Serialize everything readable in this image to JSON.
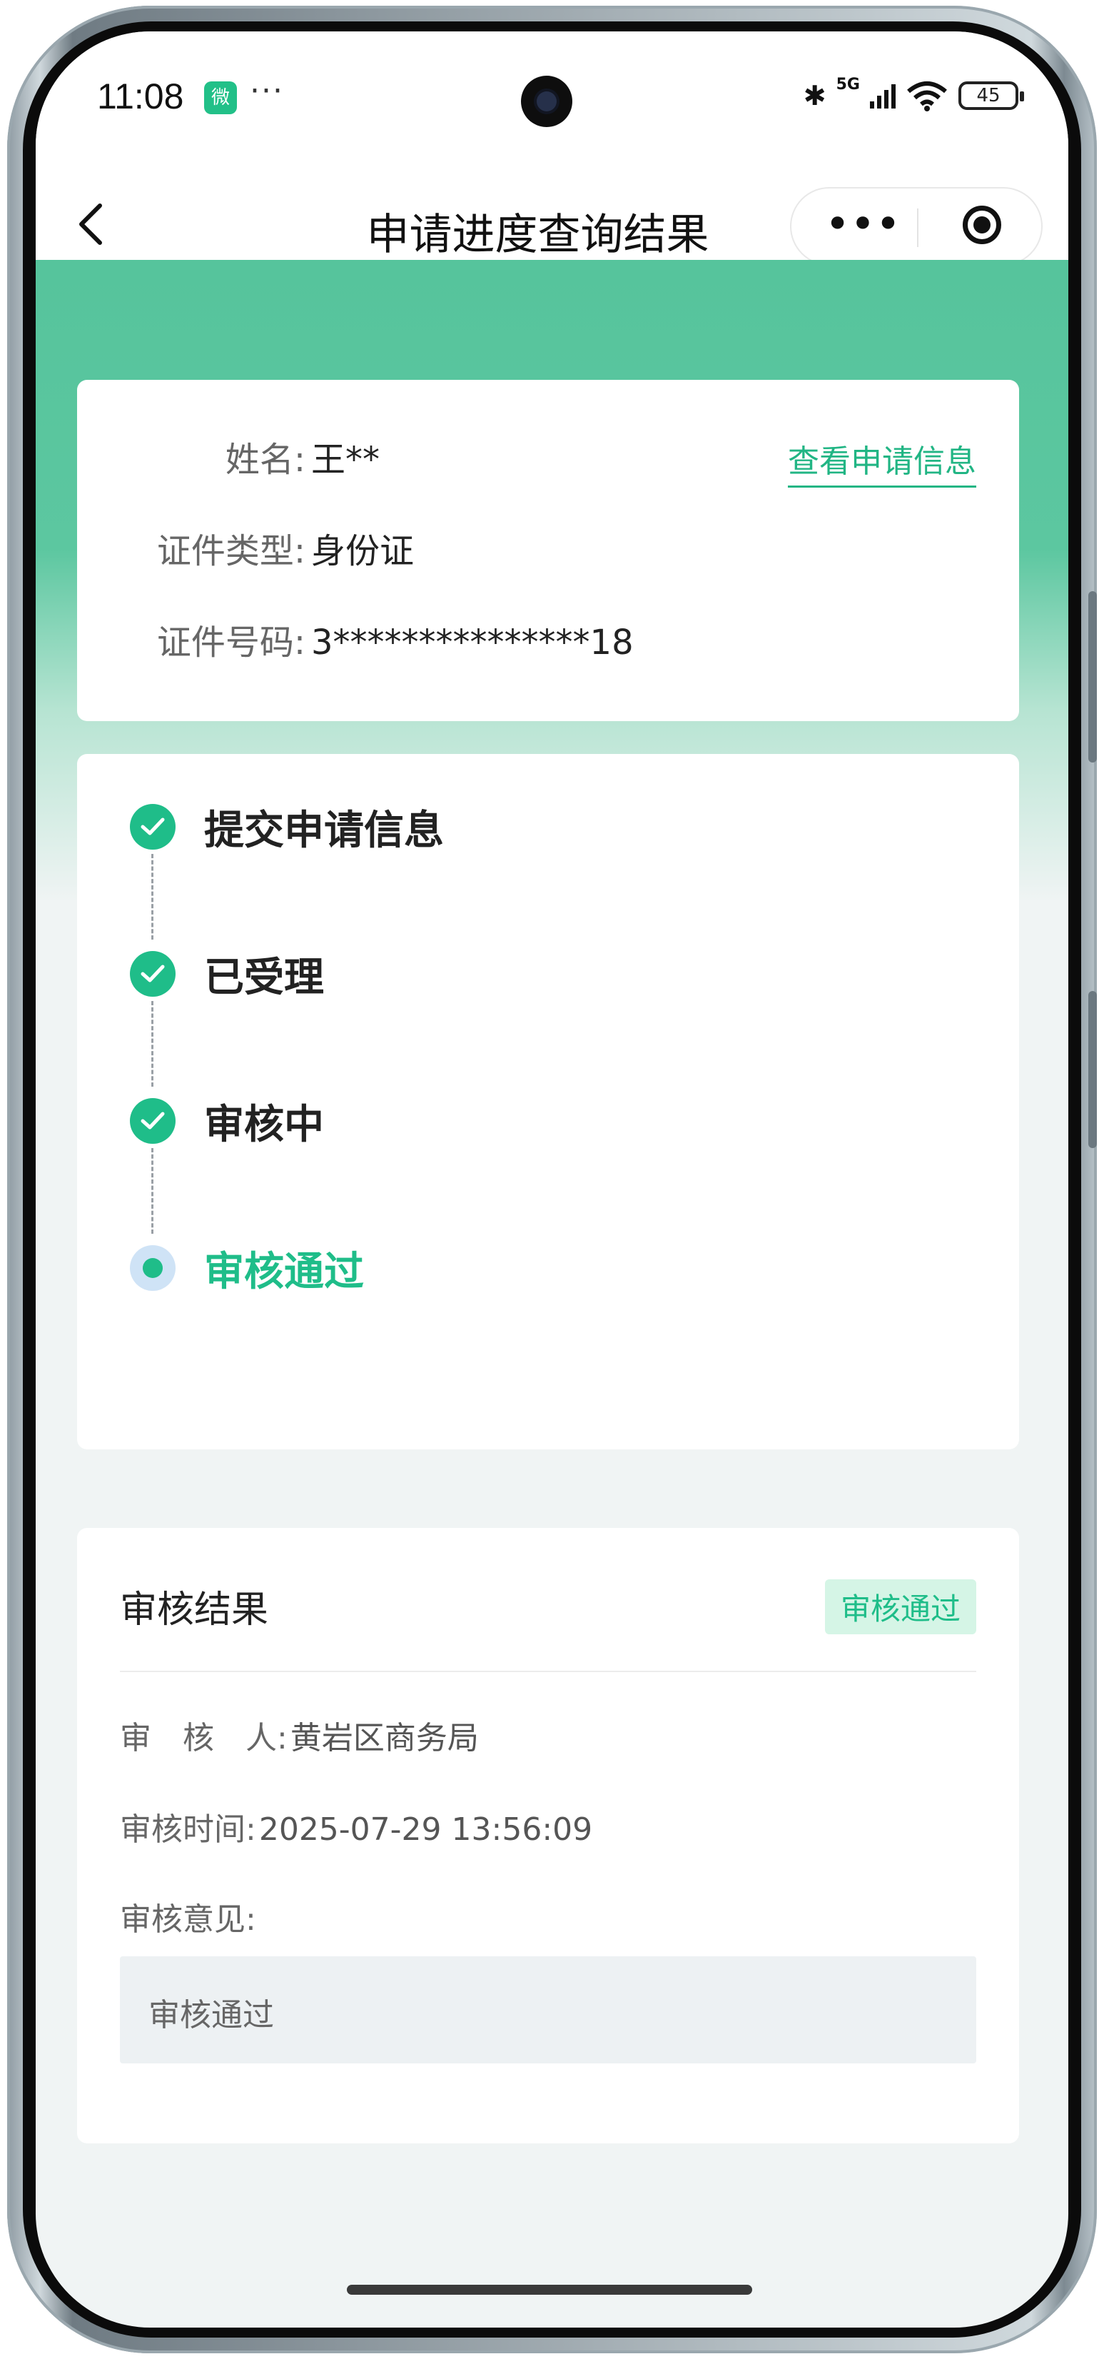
{
  "status_bar": {
    "time": "11:08",
    "app_badge": "微",
    "more": "···",
    "network": "5G",
    "battery": "45"
  },
  "navbar": {
    "title": "申请进度查询结果",
    "back_icon": "chevron-left-icon",
    "capsule_more": "•••"
  },
  "applicant": {
    "name_label": "姓名:",
    "name_value": "王**",
    "id_type_label": "证件类型:",
    "id_type_value": "身份证",
    "id_number_label": "证件号码:",
    "id_number_value": "3***************18",
    "view_link": "查看申请信息"
  },
  "progress": {
    "steps": [
      {
        "label": "提交申请信息",
        "status": "done"
      },
      {
        "label": "已受理",
        "status": "done"
      },
      {
        "label": "审核中",
        "status": "done"
      },
      {
        "label": "审核通过",
        "status": "current"
      }
    ]
  },
  "result": {
    "title": "审核结果",
    "badge": "审核通过",
    "reviewer_label": "审　核　人:",
    "reviewer_value": "黄岩区商务局",
    "time_label": "审核时间:",
    "time_value": "2025-07-29 13:56:09",
    "opinion_label": "审核意见:",
    "opinion_value": "审核通过"
  },
  "colors": {
    "accent": "#1fbd89",
    "hero": "#56c49c",
    "current_ring": "#cfe3f6"
  }
}
